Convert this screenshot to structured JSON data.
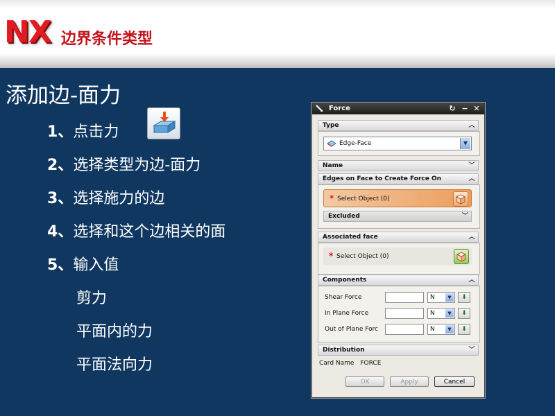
{
  "header": {
    "logo": "NX",
    "title": "边界条件类型"
  },
  "slide": {
    "title": "添加边-面力",
    "steps": [
      {
        "num": "1、",
        "text": "点击力"
      },
      {
        "num": "2、",
        "text": "选择类型为边-面力"
      },
      {
        "num": "3、",
        "text": "选择施力的边"
      },
      {
        "num": "4、",
        "text": "选择和这个边相关的面"
      },
      {
        "num": "5、",
        "text": "输入值"
      }
    ],
    "subs": [
      "剪力",
      "平面内的力",
      "平面法向力"
    ]
  },
  "dialog": {
    "title": "Force",
    "type_section": "Type",
    "type_value": "Edge-Face",
    "name_section": "Name",
    "edges_section": "Edges on Face to Create Force On",
    "select_object": "Select Object (0)",
    "excluded": "Excluded",
    "associated_section": "Associated face",
    "select_object_2": "Select Object (0)",
    "components_section": "Components",
    "components": [
      {
        "label": "Shear Force",
        "unit": "N"
      },
      {
        "label": "In Plane Force",
        "unit": "N"
      },
      {
        "label": "Out of Plane Forc",
        "unit": "N"
      }
    ],
    "distribution_section": "Distribution",
    "card_name_label": "Card Name",
    "card_name_value": "FORCE",
    "ok": "OK",
    "apply": "Apply",
    "cancel": "Cancel"
  },
  "colors": {
    "slide_bg": "#0f3760",
    "accent_red": "#e01b22",
    "select_highlight": "#f0b27c"
  }
}
